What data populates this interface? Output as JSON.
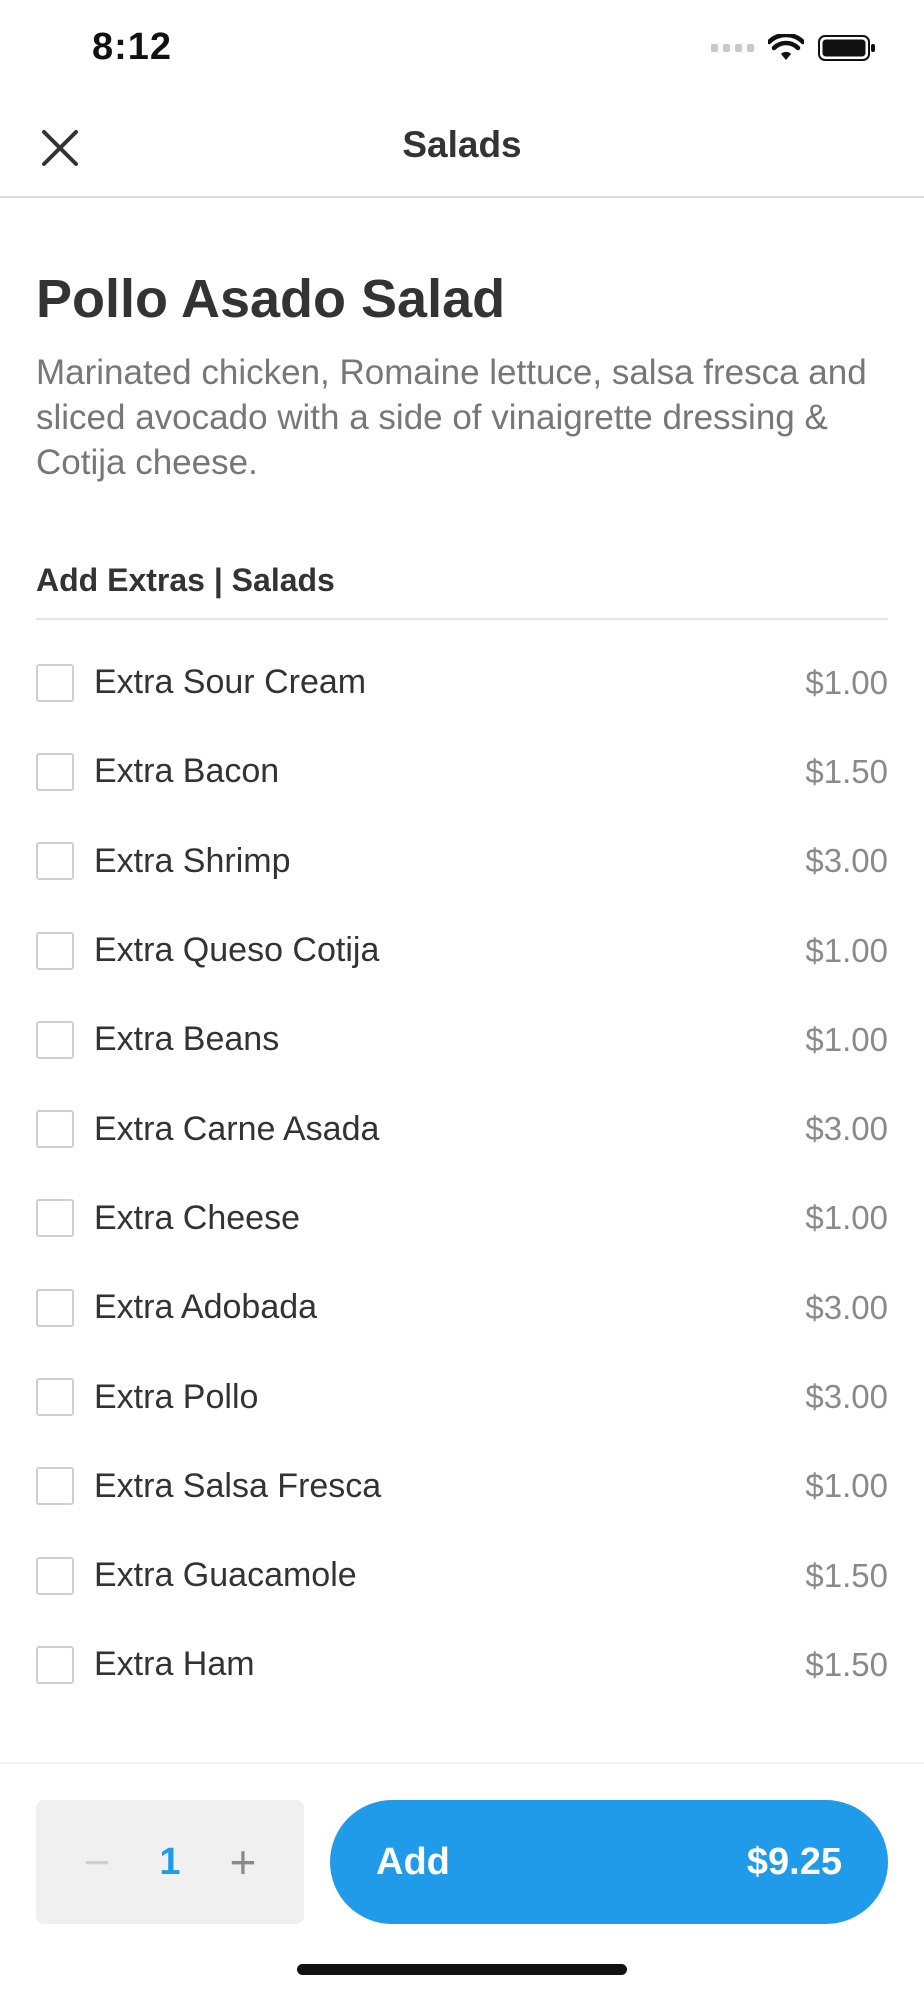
{
  "status_bar": {
    "time": "8:12"
  },
  "nav": {
    "title": "Salads",
    "close_icon": "close-icon"
  },
  "item": {
    "title": "Pollo Asado Salad",
    "description": "Marinated chicken, Romaine lettuce, salsa fresca and sliced avocado with a side of vinaigrette dressing & Cotija cheese."
  },
  "extras": {
    "header": "Add Extras | Salads",
    "items": [
      {
        "label": "Extra Sour Cream",
        "price": "$1.00"
      },
      {
        "label": "Extra Bacon",
        "price": "$1.50"
      },
      {
        "label": "Extra Shrimp",
        "price": "$3.00"
      },
      {
        "label": "Extra Queso Cotija",
        "price": "$1.00"
      },
      {
        "label": "Extra Beans",
        "price": "$1.00"
      },
      {
        "label": "Extra Carne Asada",
        "price": "$3.00"
      },
      {
        "label": "Extra Cheese",
        "price": "$1.00"
      },
      {
        "label": "Extra Adobada",
        "price": "$3.00"
      },
      {
        "label": "Extra Pollo",
        "price": "$3.00"
      },
      {
        "label": "Extra Salsa Fresca",
        "price": "$1.00"
      },
      {
        "label": "Extra Guacamole",
        "price": "$1.50"
      },
      {
        "label": "Extra Ham",
        "price": "$1.50"
      }
    ]
  },
  "quantity": {
    "minus": "−",
    "value": "1",
    "plus": "+"
  },
  "add_button": {
    "label": "Add",
    "price": "$9.25"
  },
  "colors": {
    "accent": "#1f9bea",
    "text": "#333333",
    "muted": "#777777",
    "price": "#8a8a8a"
  }
}
